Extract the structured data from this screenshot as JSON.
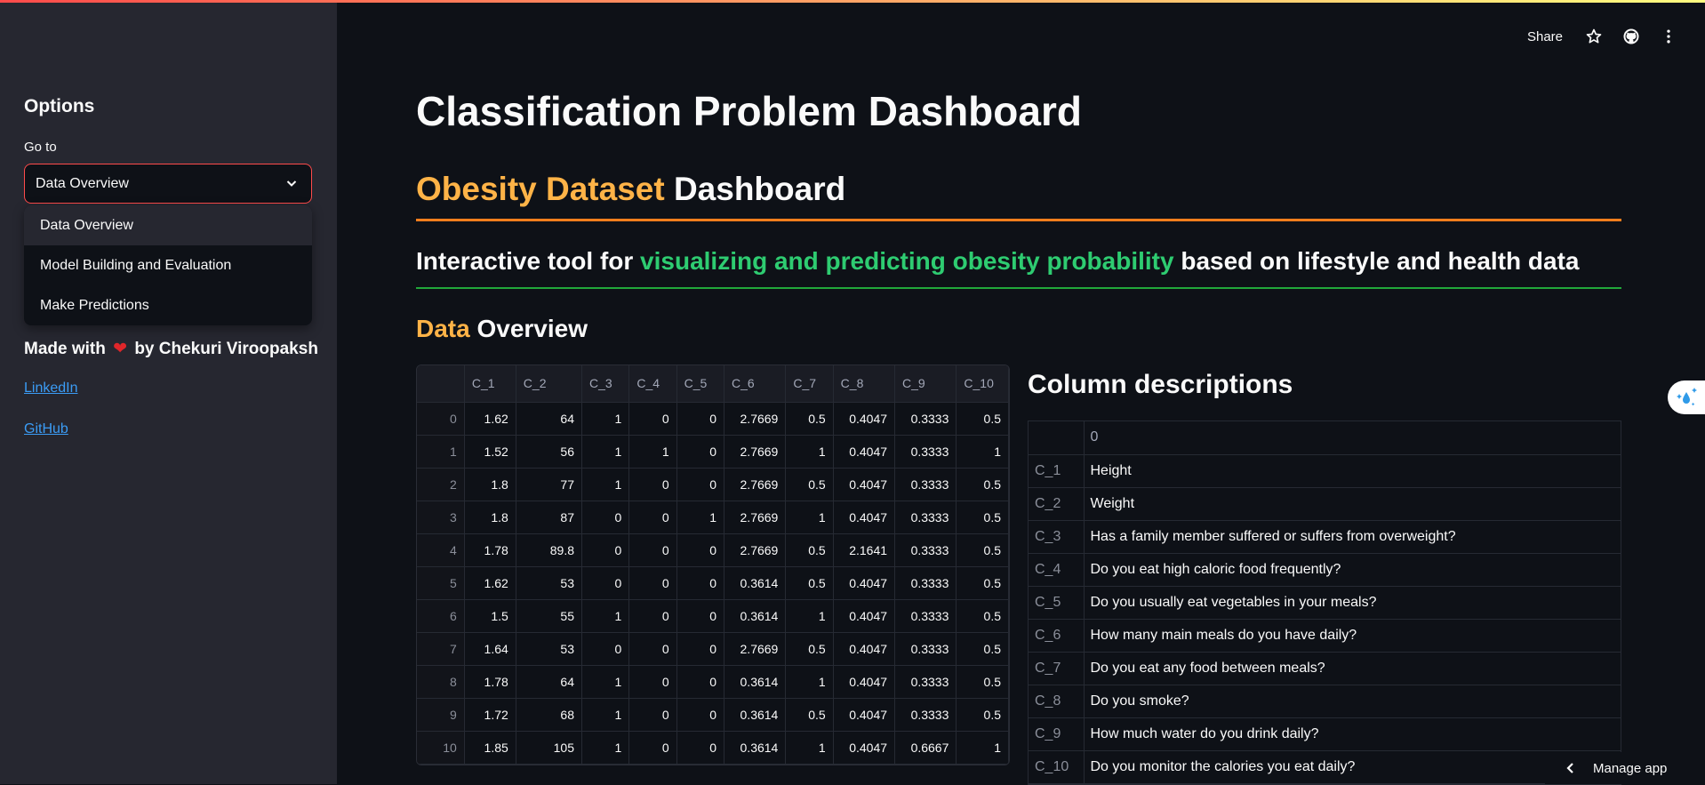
{
  "sidebar": {
    "title": "Options",
    "select_label": "Go to",
    "selected": "Data Overview",
    "options": [
      "Data Overview",
      "Model Building and Evaluation",
      "Make Predictions"
    ],
    "made_with_prefix": "Made with",
    "made_with_suffix": "by Chekuri Viroopaksh",
    "heart_icon": "❤",
    "links": [
      "LinkedIn",
      "GitHub"
    ]
  },
  "header": {
    "share_label": "Share",
    "icons": [
      "star-icon",
      "github-icon",
      "more-vert-icon"
    ]
  },
  "main": {
    "title": "Classification Problem Dashboard",
    "subtitle_highlight": "Obesity Dataset",
    "subtitle_rest": " Dashboard",
    "tagline_prefix": "Interactive tool for ",
    "tagline_highlight": "visualizing and predicting obesity probability",
    "tagline_suffix": " based on lifestyle and health data",
    "section_highlight": "Data",
    "section_rest": " Overview",
    "colors": {
      "orange": "#ffb347",
      "green": "#2ecc71",
      "rule_orange": "#f77e1d",
      "rule_green": "#21a83a"
    }
  },
  "data_table": {
    "columns": [
      "",
      "C_1",
      "C_2",
      "C_3",
      "C_4",
      "C_5",
      "C_6",
      "C_7",
      "C_8",
      "C_9",
      "C_10"
    ],
    "rows": [
      [
        "0",
        "1.62",
        "64",
        "1",
        "0",
        "0",
        "2.7669",
        "0.5",
        "0.4047",
        "0.3333",
        "0.5"
      ],
      [
        "1",
        "1.52",
        "56",
        "1",
        "1",
        "0",
        "2.7669",
        "1",
        "0.4047",
        "0.3333",
        "1"
      ],
      [
        "2",
        "1.8",
        "77",
        "1",
        "0",
        "0",
        "2.7669",
        "0.5",
        "0.4047",
        "0.3333",
        "0.5"
      ],
      [
        "3",
        "1.8",
        "87",
        "0",
        "0",
        "1",
        "2.7669",
        "1",
        "0.4047",
        "0.3333",
        "0.5"
      ],
      [
        "4",
        "1.78",
        "89.8",
        "0",
        "0",
        "0",
        "2.7669",
        "0.5",
        "2.1641",
        "0.3333",
        "0.5"
      ],
      [
        "5",
        "1.62",
        "53",
        "0",
        "0",
        "0",
        "0.3614",
        "0.5",
        "0.4047",
        "0.3333",
        "0.5"
      ],
      [
        "6",
        "1.5",
        "55",
        "1",
        "0",
        "0",
        "0.3614",
        "1",
        "0.4047",
        "0.3333",
        "0.5"
      ],
      [
        "7",
        "1.64",
        "53",
        "0",
        "0",
        "0",
        "2.7669",
        "0.5",
        "0.4047",
        "0.3333",
        "0.5"
      ],
      [
        "8",
        "1.78",
        "64",
        "1",
        "0",
        "0",
        "0.3614",
        "1",
        "0.4047",
        "0.3333",
        "0.5"
      ],
      [
        "9",
        "1.72",
        "68",
        "1",
        "0",
        "0",
        "0.3614",
        "0.5",
        "0.4047",
        "0.3333",
        "0.5"
      ],
      [
        "10",
        "1.85",
        "105",
        "1",
        "0",
        "0",
        "0.3614",
        "1",
        "0.4047",
        "0.6667",
        "1"
      ]
    ]
  },
  "column_descriptions": {
    "title": "Column descriptions",
    "header": [
      "",
      "0"
    ],
    "rows": [
      [
        "C_1",
        "Height"
      ],
      [
        "C_2",
        "Weight"
      ],
      [
        "C_3",
        "Has a family member suffered or suffers from overweight?"
      ],
      [
        "C_4",
        "Do you eat high caloric food frequently?"
      ],
      [
        "C_5",
        "Do you usually eat vegetables in your meals?"
      ],
      [
        "C_6",
        "How many main meals do you have daily?"
      ],
      [
        "C_7",
        "Do you eat any food between meals?"
      ],
      [
        "C_8",
        "Do you smoke?"
      ],
      [
        "C_9",
        "How much water do you drink daily?"
      ],
      [
        "C_10",
        "Do you monitor the calories you eat daily?"
      ]
    ]
  },
  "footer": {
    "manage_app_label": "Manage app"
  }
}
